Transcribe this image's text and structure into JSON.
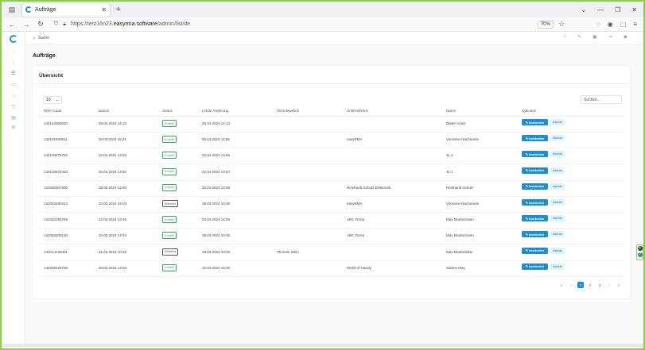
{
  "browser": {
    "tab_title": "Aufträge",
    "tab_close": "✕",
    "new_tab": "+",
    "url_prefix": "https://test16n23.",
    "url_host": "easyrma.software",
    "url_path": "/admin/list/de",
    "zoom": "70%"
  },
  "app": {
    "search_placeholder": "Suche",
    "page_title": "Aufträge",
    "card_title": "Übersicht",
    "per_page": "10",
    "table_search": "Suchen...",
    "columns": [
      "RMA-Code",
      "Datum",
      "Status",
      "Letzte Änderung",
      "Verantwortlich",
      "Unternehmen",
      "Name",
      "Optionen"
    ],
    "rows": [
      {
        "code": "142144000030",
        "date": "08.04.2024 14:13",
        "status": "Erstellt",
        "changed": "08.04.2024 14:13",
        "resp": "",
        "company": "",
        "name": "Dieter Antes"
      },
      {
        "code": "142131620511",
        "date": "02.04.2024 16:21",
        "status": "Erstellt",
        "changed": "05.04.2024 11:55",
        "resp": "",
        "company": "easyRMA",
        "name": "Vorname Nachname"
      },
      {
        "code": "142130875752",
        "date": "02.04.2024 13:52",
        "status": "Erstellt",
        "changed": "02.04.2024 13:56",
        "resp": "",
        "company": "",
        "name": "11 1"
      },
      {
        "code": "142130875420",
        "date": "02.04.2024 13:52",
        "status": "Erstellt",
        "changed": "02.04.2024 13:54",
        "resp": "",
        "company": "",
        "name": "11 1"
      },
      {
        "code": "142060307600",
        "date": "28.03.2024 12:50",
        "status": "Erstellt",
        "changed": "28.03.2024 13:08",
        "resp": "",
        "company": "Reinhardt Schulz Elektronik",
        "name": "Reinhardt Schulz"
      },
      {
        "code": "142022290413",
        "date": "22.03.2024 15:03",
        "status": "Wartend",
        "changed": "28.03.2024 10:46",
        "resp": "",
        "company": "easyRMA",
        "name": "Vorname Nachname"
      },
      {
        "code": "142022283796",
        "date": "22.03.2024 13:46",
        "status": "Erstellt",
        "changed": "02.04.2024 14:29",
        "resp": "",
        "company": "ABC Firma",
        "name": "Max Mustermann"
      },
      {
        "code": "142022200130",
        "date": "22.03.2024 13:34",
        "status": "Erstellt",
        "changed": "28.03.2024 10:46",
        "resp": "",
        "company": "ABC Firma",
        "name": "Max Mustermann"
      },
      {
        "code": "142014126401",
        "date": "21.03.2024 10:32",
        "status": "Wartend",
        "changed": "28.03.2024 10:46",
        "resp": "Thomas Stein",
        "company": "",
        "name": "Max Musterleber"
      },
      {
        "code": "142008226796",
        "date": "20.03.2024 14:03",
        "status": "Erstellt",
        "changed": "20.03.2024 15:00",
        "resp": "",
        "company": "World of Handy",
        "name": "Sabine May"
      }
    ],
    "edit_label": "✎ bearbeiten",
    "archive_label": "Archiv",
    "pager": [
      "«",
      "‹",
      "1",
      "2",
      "3",
      "›",
      "»"
    ],
    "status_colors": {
      "Erstellt": "#3aa85a",
      "Wartend": "#555555"
    },
    "accent": "#1a8fd9"
  }
}
